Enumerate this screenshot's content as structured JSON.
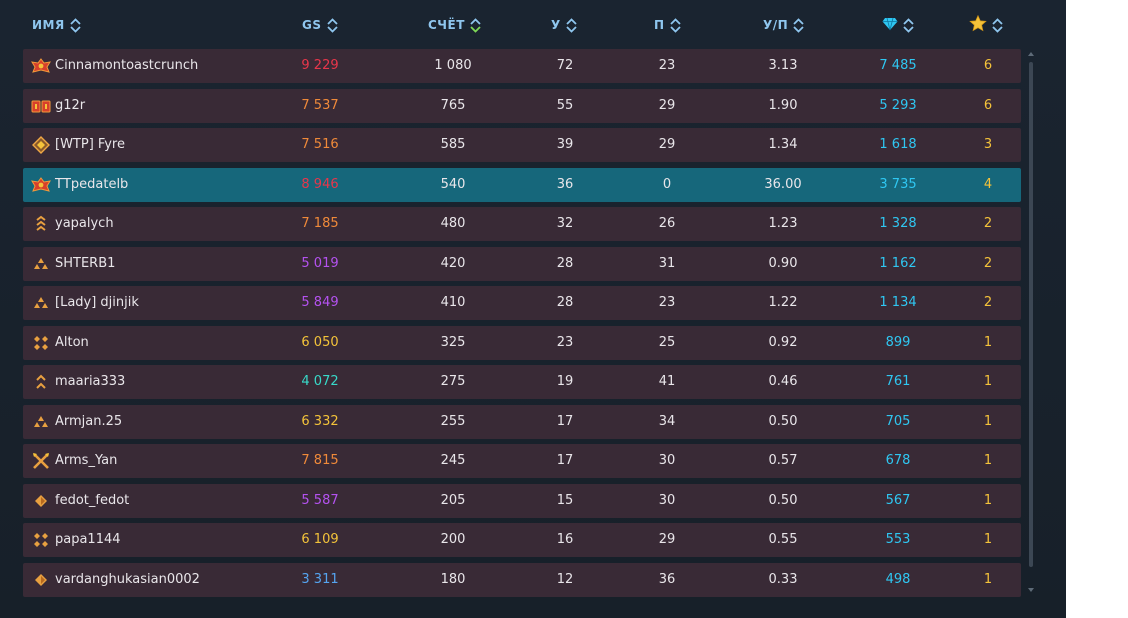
{
  "header": {
    "name": "ИМЯ",
    "gs": "GS",
    "score": "СЧЁТ",
    "kills": "У",
    "deaths": "П",
    "kd": "У/П",
    "gem_icon": "diamond-icon",
    "star_icon": "star-icon"
  },
  "colors": {
    "gs_red": "#e8364b",
    "gs_orange": "#f08a3a",
    "gs_yellow": "#f3c33a",
    "gs_purple": "#b452f0",
    "gs_teal": "#38d9c9",
    "gs_blue": "#55a4f0",
    "gem": "#2fc7f2",
    "star": "#f5c33a",
    "row_bg": "#392a36",
    "row_self_bg": "#16677b"
  },
  "rows": [
    {
      "name": "Cinnamontoastcrunch",
      "gs": "9 229",
      "gs_color": "#e8364b",
      "score": "1 080",
      "kills": "72",
      "deaths": "23",
      "kd": "3.13",
      "gems": "7 485",
      "stars": "6",
      "rank_icon": "rank-emblem-red-icon",
      "self": false
    },
    {
      "name": "g12r",
      "gs": "7 537",
      "gs_color": "#f08a3a",
      "score": "765",
      "kills": "55",
      "deaths": "29",
      "kd": "1.90",
      "gems": "5 293",
      "stars": "6",
      "rank_icon": "rank-emblem-double-red-icon",
      "self": false
    },
    {
      "name": "[WTP] Fyre",
      "gs": "7 516",
      "gs_color": "#f08a3a",
      "score": "585",
      "kills": "39",
      "deaths": "29",
      "kd": "1.34",
      "gems": "1 618",
      "stars": "3",
      "rank_icon": "rank-emblem-gold-diamond-icon",
      "self": false
    },
    {
      "name": "ТТpedatelb",
      "gs": "8 946",
      "gs_color": "#e8364b",
      "score": "540",
      "kills": "36",
      "deaths": "0",
      "kd": "36.00",
      "gems": "3 735",
      "stars": "4",
      "rank_icon": "rank-emblem-red-icon",
      "self": true
    },
    {
      "name": "yapalych",
      "gs": "7 185",
      "gs_color": "#f08a3a",
      "score": "480",
      "kills": "32",
      "deaths": "26",
      "kd": "1.23",
      "gems": "1 328",
      "stars": "2",
      "rank_icon": "rank-chevrons-icon",
      "self": false
    },
    {
      "name": "SHTERB1",
      "gs": "5 019",
      "gs_color": "#b452f0",
      "score": "420",
      "kills": "28",
      "deaths": "31",
      "kd": "0.90",
      "gems": "1 162",
      "stars": "2",
      "rank_icon": "rank-triangle-icon",
      "self": false
    },
    {
      "name": "[Lady] djinjik",
      "gs": "5 849",
      "gs_color": "#b452f0",
      "score": "410",
      "kills": "28",
      "deaths": "23",
      "kd": "1.22",
      "gems": "1 134",
      "stars": "2",
      "rank_icon": "rank-triangle-icon",
      "self": false
    },
    {
      "name": "Alton",
      "gs": "6 050",
      "gs_color": "#f3c33a",
      "score": "325",
      "kills": "23",
      "deaths": "25",
      "kd": "0.92",
      "gems": "899",
      "stars": "1",
      "rank_icon": "rank-four-diamonds-icon",
      "self": false
    },
    {
      "name": "maaria333",
      "gs": "4 072",
      "gs_color": "#38d9c9",
      "score": "275",
      "kills": "19",
      "deaths": "41",
      "kd": "0.46",
      "gems": "761",
      "stars": "1",
      "rank_icon": "rank-double-chevron-icon",
      "self": false
    },
    {
      "name": "Armjan.25",
      "gs": "6 332",
      "gs_color": "#f3c33a",
      "score": "255",
      "kills": "17",
      "deaths": "34",
      "kd": "0.50",
      "gems": "705",
      "stars": "1",
      "rank_icon": "rank-triangle-icon",
      "self": false
    },
    {
      "name": "Arms_Yan",
      "gs": "7 815",
      "gs_color": "#f08a3a",
      "score": "245",
      "kills": "17",
      "deaths": "30",
      "kd": "0.57",
      "gems": "678",
      "stars": "1",
      "rank_icon": "rank-crossed-swords-icon",
      "self": false
    },
    {
      "name": "fedot_fedot",
      "gs": "5 587",
      "gs_color": "#b452f0",
      "score": "205",
      "kills": "15",
      "deaths": "30",
      "kd": "0.50",
      "gems": "567",
      "stars": "1",
      "rank_icon": "rank-diamond-icon",
      "self": false
    },
    {
      "name": "papa1144",
      "gs": "6 109",
      "gs_color": "#f3c33a",
      "score": "200",
      "kills": "16",
      "deaths": "29",
      "kd": "0.55",
      "gems": "553",
      "stars": "1",
      "rank_icon": "rank-four-diamonds-icon",
      "self": false
    },
    {
      "name": "vardanghukasian0002",
      "gs": "3 311",
      "gs_color": "#55a4f0",
      "score": "180",
      "kills": "12",
      "deaths": "36",
      "kd": "0.33",
      "gems": "498",
      "stars": "1",
      "rank_icon": "rank-diamond-icon",
      "self": false
    }
  ]
}
